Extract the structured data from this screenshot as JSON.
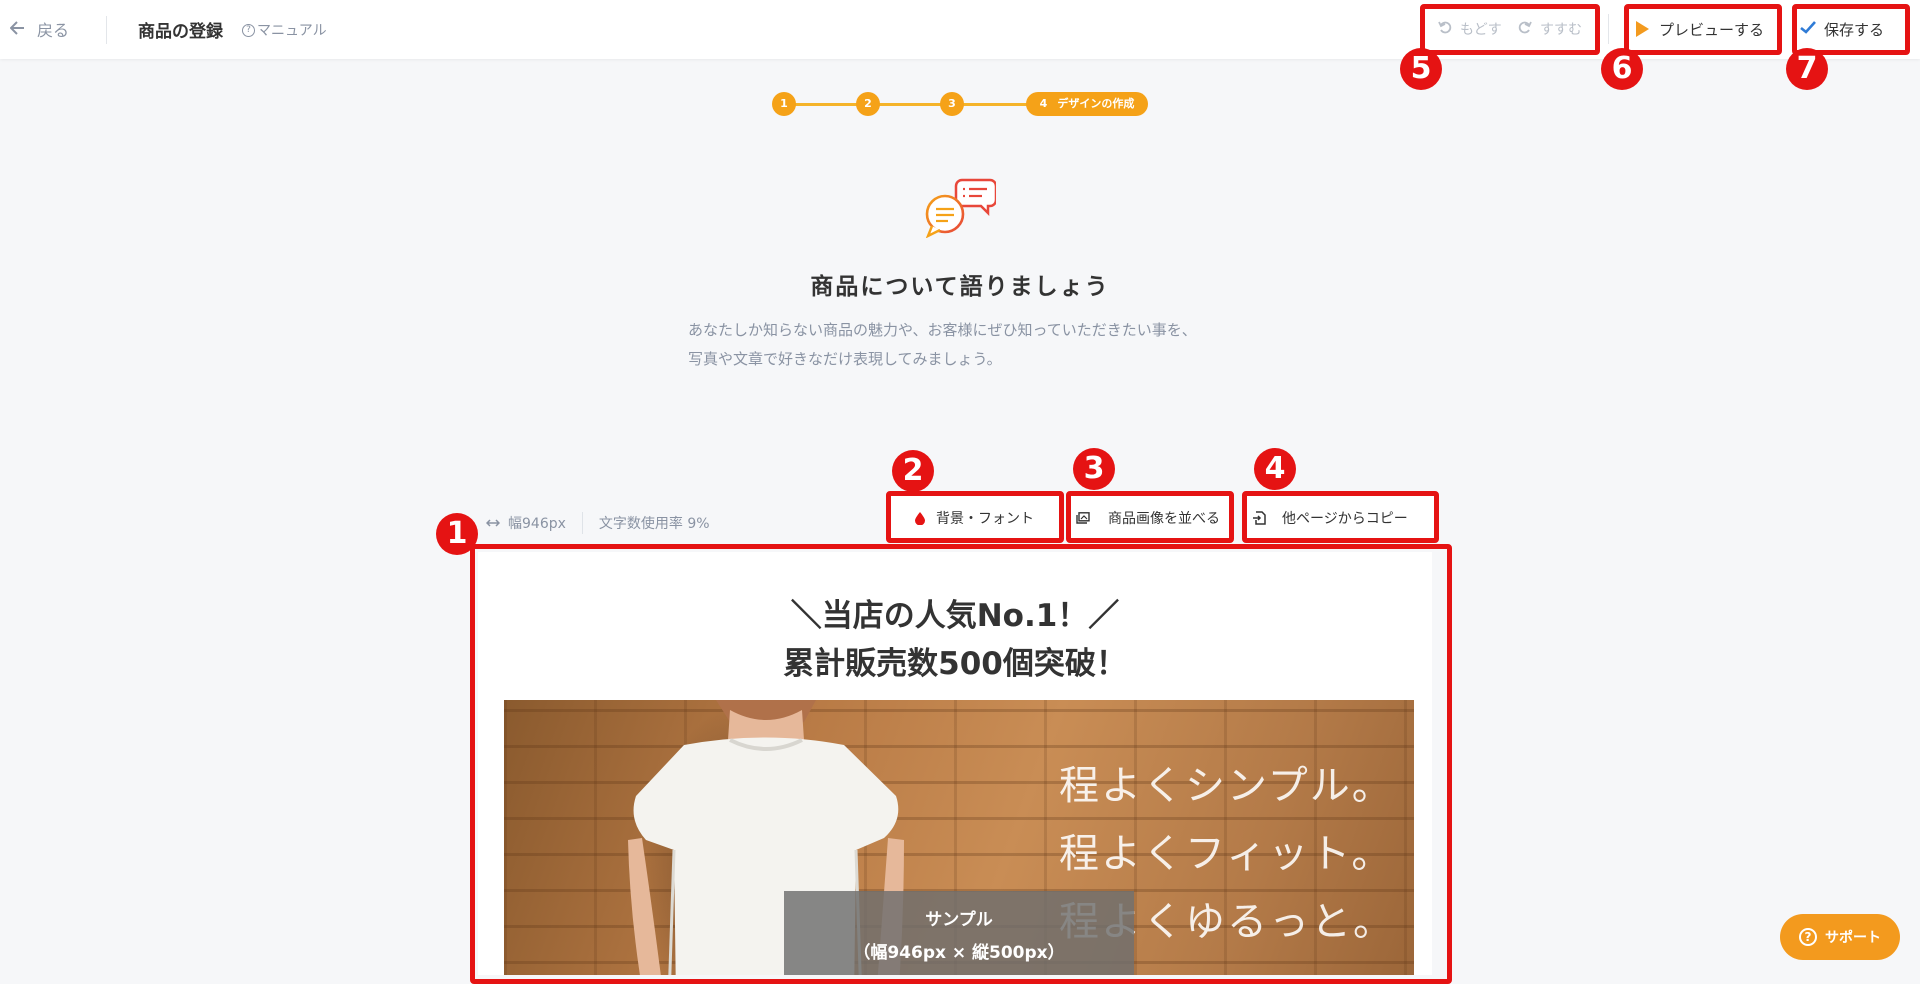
{
  "header": {
    "back_label": "戻る",
    "page_title": "商品の登録",
    "manual_label": "マニュアル",
    "undo_label": "もどす",
    "redo_label": "すすむ",
    "preview_label": "プレビューする",
    "save_label": "保存する"
  },
  "steps": {
    "items": [
      "1",
      "2",
      "3",
      "4"
    ],
    "active_label": "デザインの作成"
  },
  "hero": {
    "title": "商品について語りましょう",
    "desc_line1": "あなたしか知らない商品の魅力や、お客様にぜひ知っていただきたい事を、",
    "desc_line2": "写真や文章で好きなだけ表現してみましょう。"
  },
  "toolbar": {
    "width_label": "幅946px",
    "usage_label": "文字数使用率 9%",
    "bg_font_label": "背景・フォント",
    "arrange_images_label": "商品画像を並べる",
    "copy_label": "他ページからコピー"
  },
  "canvas": {
    "headline1": "＼当店の人気No.1！／",
    "headline2": "累計販売数500個突破！",
    "overlay_lines": [
      "程よくシンプル。",
      "程よくフィット。",
      "程よくゆるっと。"
    ],
    "sample_title": "サンプル",
    "sample_size": "（幅946px × 縦500px）"
  },
  "markers": [
    "1",
    "2",
    "3",
    "4",
    "5",
    "6",
    "7"
  ],
  "support_label": "サポート",
  "colors": {
    "accent": "#f5a218",
    "annotation_red": "#e51313",
    "muted_text": "#8a93a3",
    "check_blue": "#2f7bd6"
  }
}
